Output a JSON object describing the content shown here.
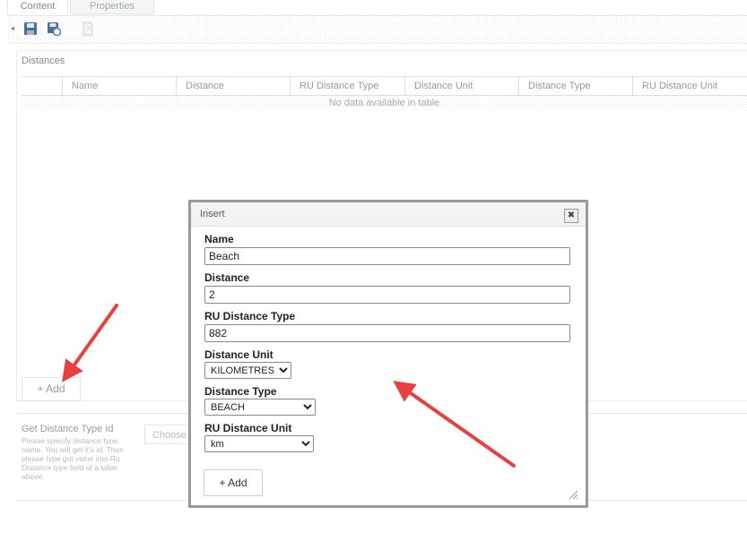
{
  "tabs": [
    {
      "label": "Content"
    },
    {
      "label": "Properties"
    }
  ],
  "toolbar": {
    "icons": [
      "back-arrow-icon",
      "save-icon",
      "save-refresh-icon",
      "page-icon"
    ]
  },
  "distances_panel": {
    "title": "Distances",
    "columns": [
      "Name",
      "Distance",
      "RU Distance Type",
      "Distance Unit",
      "Distance Type",
      "RU Distance Unit"
    ],
    "empty_text": "No data available in table",
    "add_label": "Add"
  },
  "get_distance_type": {
    "title": "Get Distance Type Id",
    "description": "Please specify distance type name. You will get it's id. Then please type got value into Ru Distance type field of a table above.",
    "choose_placeholder": "Choose"
  },
  "dialog": {
    "title": "Insert",
    "fields": {
      "name": {
        "label": "Name",
        "value": "Beach"
      },
      "distance": {
        "label": "Distance",
        "value": "2"
      },
      "ru_distance_type": {
        "label": "RU Distance Type",
        "value": "882"
      },
      "distance_unit": {
        "label": "Distance Unit",
        "value": "KILOMETRES"
      },
      "distance_type": {
        "label": "Distance Type",
        "value": "BEACH"
      },
      "ru_distance_unit": {
        "label": "RU Distance Unit",
        "value": "km"
      }
    },
    "add_label": "Add"
  },
  "colors": {
    "annotation_arrow": "#e8403f",
    "dialog_border": "#999999"
  }
}
